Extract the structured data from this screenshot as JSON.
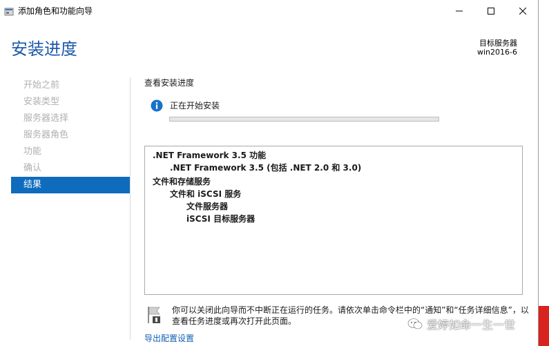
{
  "window": {
    "title": "添加角色和功能向导"
  },
  "header": {
    "page_title": "安装进度",
    "server_label": "目标服务器",
    "server_name": "win2016-6"
  },
  "nav": {
    "items": [
      {
        "label": "开始之前",
        "active": false
      },
      {
        "label": "安装类型",
        "active": false
      },
      {
        "label": "服务器选择",
        "active": false
      },
      {
        "label": "服务器角色",
        "active": false
      },
      {
        "label": "功能",
        "active": false
      },
      {
        "label": "确认",
        "active": false
      },
      {
        "label": "结果",
        "active": true
      }
    ]
  },
  "content": {
    "section_label": "查看安装进度",
    "status_text": "正在开始安装",
    "progress_percent": 0,
    "features": [
      ".NET Framework 3.5 功能",
      ".NET Framework 3.5 (包括 .NET 2.0 和 3.0)",
      "文件和存储服务",
      "文件和 iSCSI 服务",
      "文件服务器",
      "iSCSI 目标服务器"
    ],
    "notice_line1": "你可以关闭此向导而不中断正在运行的任务。请依次单击命令栏中的“通知”和“任务详细信息”，以",
    "notice_line2": "查看任务进度或再次打开此页面。",
    "export_link": "导出配置设置"
  },
  "watermark": {
    "text": "爱婷如命一生一世"
  },
  "colors": {
    "accent": "#0f6cbd",
    "title_blue": "#1e5aa8",
    "link": "#0f5fb3",
    "nav_disabled": "#b0b0b0"
  },
  "icons": {
    "app": "wizard-app-icon",
    "info": "info-icon",
    "notice": "flag-notification-icon",
    "minimize": "minimize-icon",
    "maximize": "maximize-icon",
    "close": "close-icon",
    "watermark": "wechat-icon"
  }
}
